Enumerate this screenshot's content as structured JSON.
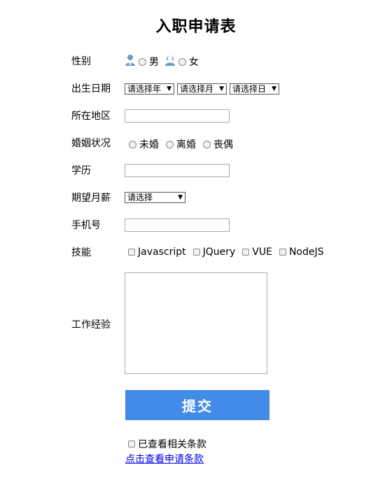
{
  "page": {
    "title": "入职申请表"
  },
  "form": {
    "gender": {
      "label": "性别",
      "options": [
        "男",
        "女"
      ]
    },
    "birth": {
      "label": "出生日期",
      "year": "请选择年",
      "month": "请选择月",
      "day": "请选择日"
    },
    "region": {
      "label": "所在地区",
      "value": ""
    },
    "marital": {
      "label": "婚姻状况",
      "options": [
        "未婚",
        "离婚",
        "丧偶"
      ]
    },
    "education": {
      "label": "学历",
      "value": ""
    },
    "salary": {
      "label": "期望月薪",
      "selected": "请选择"
    },
    "phone": {
      "label": "手机号",
      "value": ""
    },
    "skills": {
      "label": "技能",
      "options": [
        "Javascript",
        "JQuery",
        "VUE",
        "NodeJS"
      ]
    },
    "experience": {
      "label": "工作经验",
      "value": ""
    },
    "submit_label": "提交",
    "agree_label": "已查看相关条款",
    "terms_link": "点击查看申请条款"
  },
  "colors": {
    "accent": "#428be8",
    "link": "#0000ee",
    "icon": "#6f9bc2"
  }
}
